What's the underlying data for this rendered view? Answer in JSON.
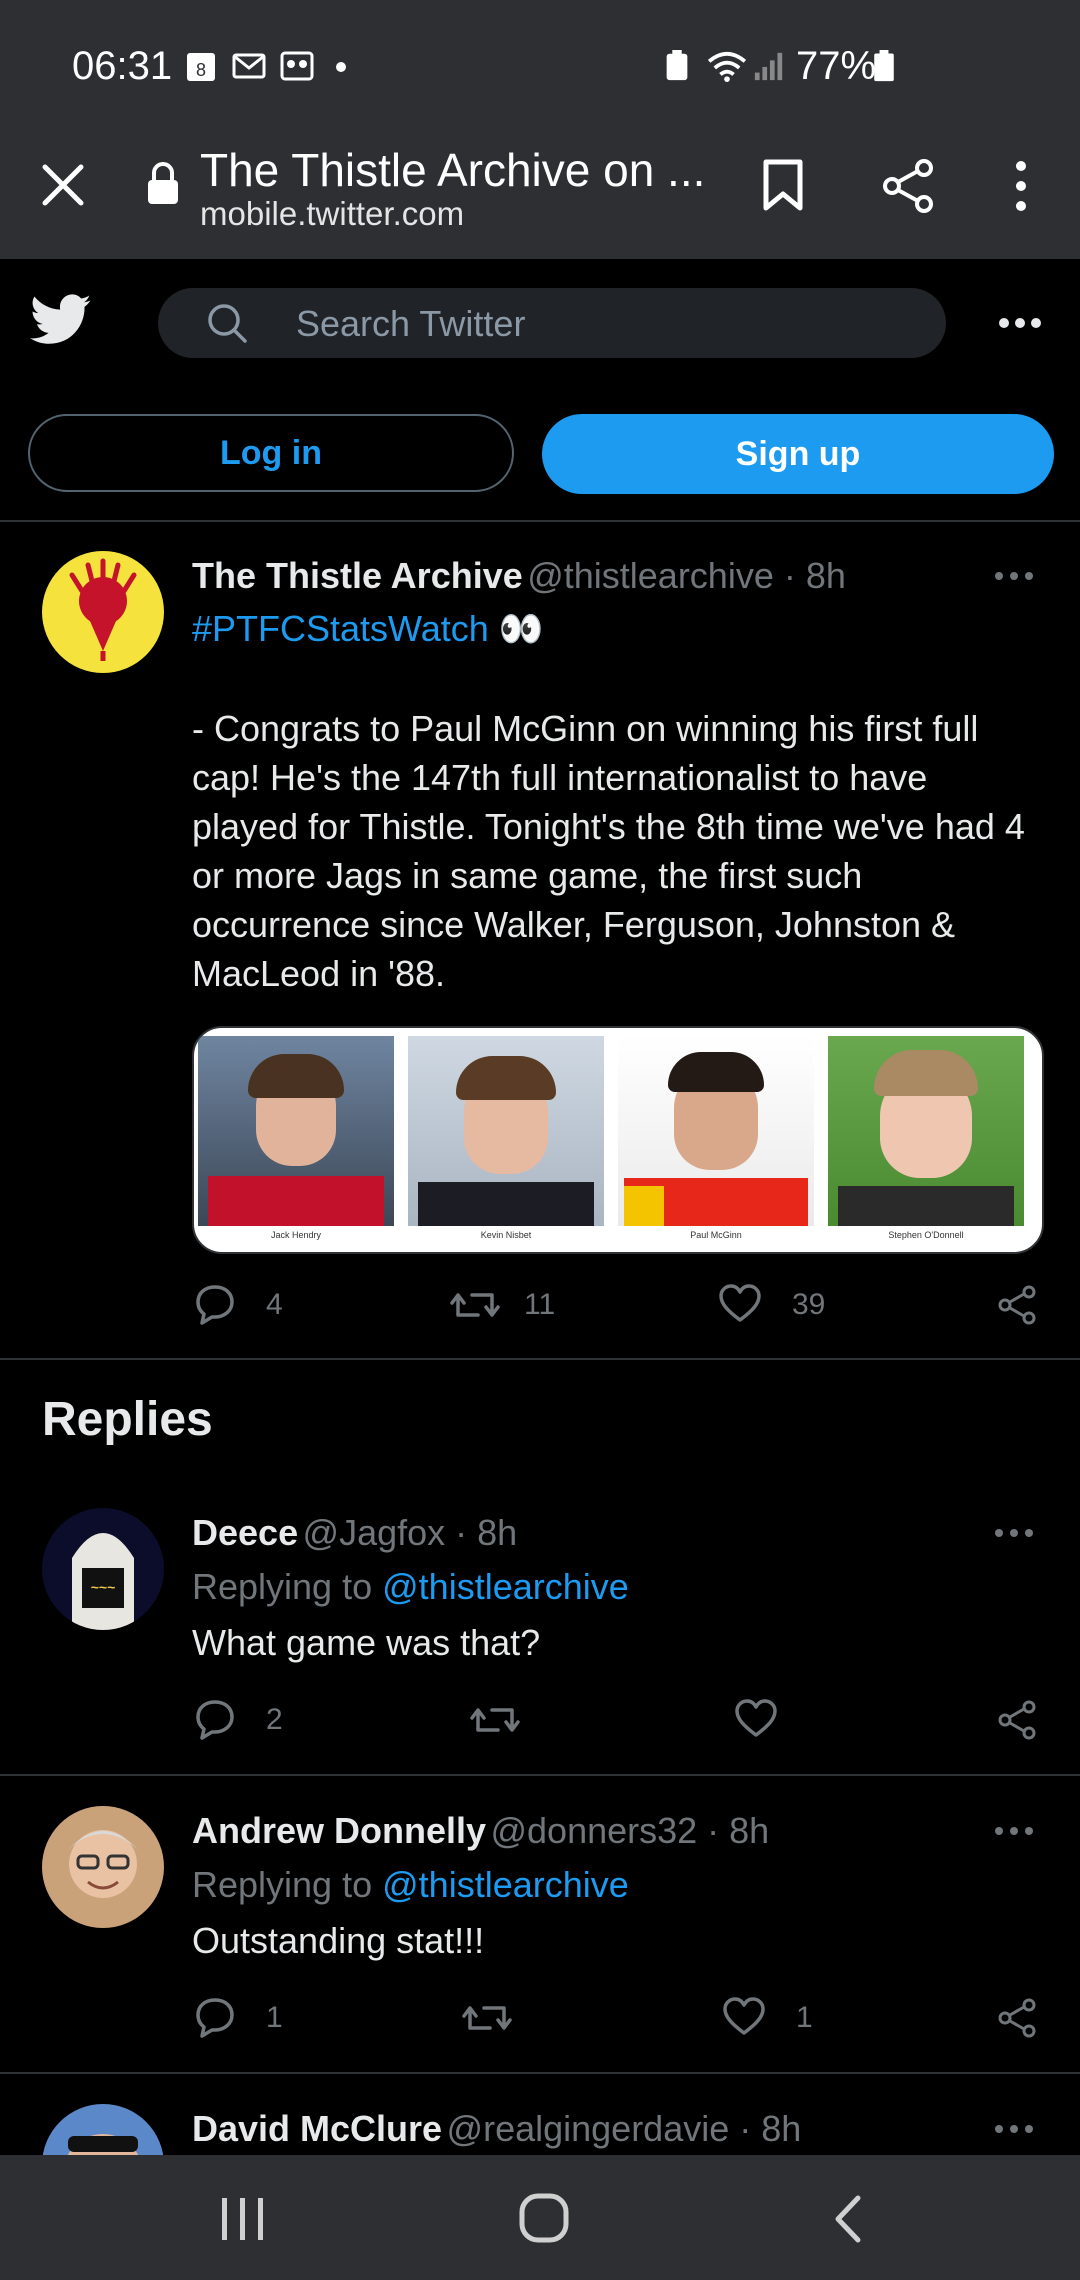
{
  "status_bar": {
    "time": "06:31",
    "notif_badge": "8",
    "battery": "77%"
  },
  "browser": {
    "title": "The Thistle Archive on ...",
    "url": "mobile.twitter.com"
  },
  "header": {
    "search_placeholder": "Search Twitter",
    "login_label": "Log in",
    "signup_label": "Sign up"
  },
  "tweet": {
    "name": "The Thistle Archive",
    "handle": "@thistlearchive · 8h",
    "hashtag": "#PTFCStatsWatch",
    "emoji": "👀",
    "text": "- Congrats to Paul McGinn on winning his first full cap! He's the 147th full internationalist to have played for Thistle. Tonight's the 8th time we've had 4 or more Jags in same game, the first such occurrence since Walker, Ferguson, Johnston & MacLeod in '88.",
    "photos": [
      "Jack Hendry",
      "Kevin Nisbet",
      "Paul McGinn",
      "Stephen O'Donnell"
    ],
    "replies": "4",
    "retweets": "11",
    "likes": "39"
  },
  "replies_heading": "Replies",
  "replies": [
    {
      "name": "Deece",
      "handle": "@Jagfox · 8h",
      "replying_prefix": "Replying to",
      "replying_to": "@thistlearchive",
      "text": "What game was that?",
      "replies": "2",
      "retweets": "",
      "likes": ""
    },
    {
      "name": "Andrew Donnelly",
      "handle": "@donners32 · 8h",
      "replying_prefix": "Replying to",
      "replying_to": "@thistlearchive",
      "text": "Outstanding stat!!!",
      "replies": "1",
      "retweets": "",
      "likes": "1"
    },
    {
      "name": "David McClure",
      "handle": "@realgingerdavie · 8h"
    }
  ],
  "colors": {
    "accent": "#1d9bf0",
    "background": "#000000",
    "chrome": "#2d2f33"
  }
}
